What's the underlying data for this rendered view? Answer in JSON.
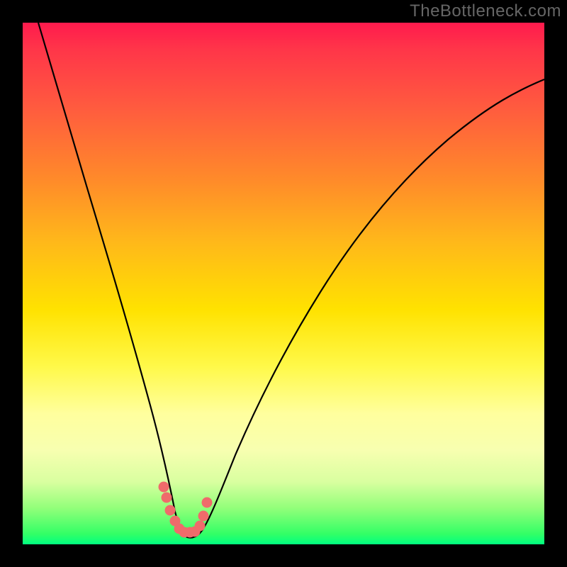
{
  "watermark": "TheBottleneck.com",
  "chart_data": {
    "type": "line",
    "title": "",
    "xlabel": "",
    "ylabel": "",
    "xlim": [
      0,
      100
    ],
    "ylim": [
      0,
      100
    ],
    "series": [
      {
        "name": "bottleneck-curve",
        "x": [
          3,
          5,
          8,
          12,
          16,
          20,
          24,
          26,
          28,
          29,
          30,
          31,
          32,
          34,
          36,
          40,
          46,
          54,
          64,
          76,
          90,
          100
        ],
        "values": [
          100,
          88,
          74,
          60,
          46,
          33,
          20,
          14,
          8,
          5,
          3,
          2,
          2,
          3,
          6,
          12,
          22,
          35,
          49,
          62,
          75,
          83
        ]
      }
    ],
    "markers": {
      "name": "highlight-points",
      "color": "#ef6b6b",
      "x": [
        27.0,
        27.5,
        28.3,
        29.2,
        30.0,
        31.0,
        32.0,
        33.0,
        34.0,
        34.6,
        35.3
      ],
      "values": [
        11.0,
        9.0,
        6.5,
        4.5,
        3.0,
        2.3,
        2.3,
        2.5,
        3.5,
        5.5,
        8.0
      ]
    },
    "gradient_stops": [
      {
        "pos": 0,
        "color": "#ff1a4d"
      },
      {
        "pos": 55,
        "color": "#ffe200"
      },
      {
        "pos": 82,
        "color": "#f7ffb0"
      },
      {
        "pos": 100,
        "color": "#00ff80"
      }
    ]
  }
}
